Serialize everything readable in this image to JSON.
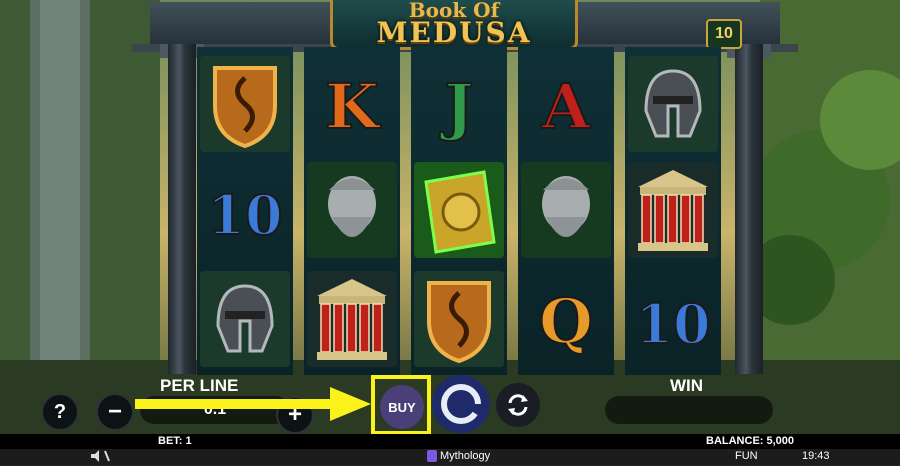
{
  "game": {
    "logo_line1": "Book Of",
    "logo_line2": "MEDUSA",
    "lines_count": "10"
  },
  "reels": [
    [
      "shield",
      "ten",
      "helmet"
    ],
    [
      "k",
      "statue",
      "temple"
    ],
    [
      "j",
      "book",
      "shield"
    ],
    [
      "a",
      "statue",
      "q"
    ],
    [
      "helmet",
      "temple",
      "ten"
    ]
  ],
  "symbols": {
    "k": "K",
    "j": "J",
    "a": "A",
    "q": "Q",
    "ten": "10"
  },
  "controls": {
    "per_line_label": "PER LINE",
    "bet_value": "0.1",
    "win_label": "WIN",
    "help_label": "?",
    "minus_label": "−",
    "plus_label": "+",
    "buy_label": "BUY"
  },
  "status": {
    "bet": "BET: 1",
    "balance": "BALANCE: 5,000",
    "mode": "FUN",
    "time": "19:43",
    "provider": "Mythology"
  },
  "colors": {
    "highlight": "#fbf21c",
    "buy_button": "#4a3f78",
    "spin_button": "#1f2a6b"
  }
}
